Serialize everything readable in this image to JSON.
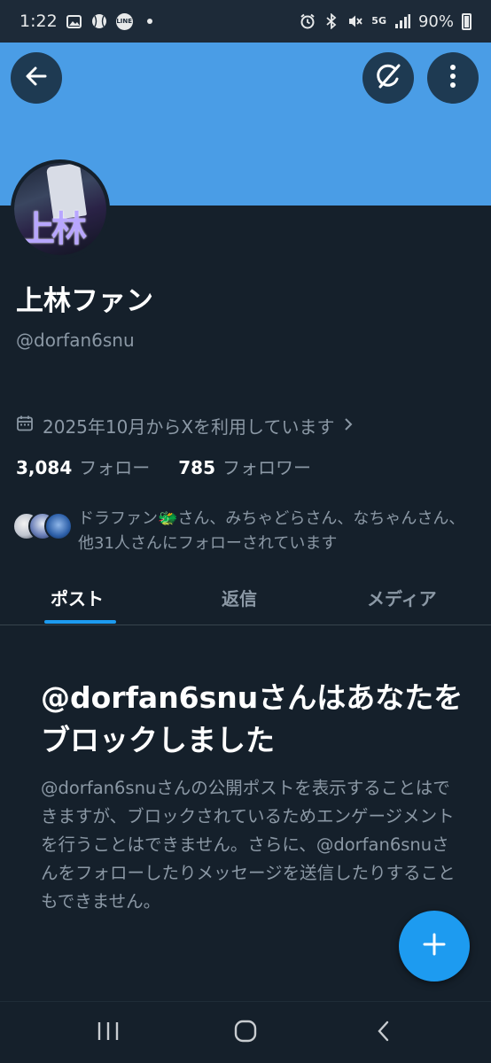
{
  "status_bar": {
    "time": "1:22",
    "network": "5G",
    "battery": "90%"
  },
  "header": {
    "back_icon": "arrow-left-icon",
    "grok_icon": "grok-icon",
    "more_icon": "more-vertical-icon",
    "banner_color": "#4a9de6"
  },
  "profile": {
    "avatar_kanji": "上林",
    "display_name": "上林ファン",
    "handle": "@dorfan6snu",
    "joined": "2025年10月からXを利用しています",
    "following_count": "3,084",
    "following_label": "フォロー",
    "followers_count": "785",
    "followers_label": "フォロワー",
    "followed_by": "ドラファン🐲さん、みちゃどらさん、なちゃんさん、他31人さんにフォローされています"
  },
  "tabs": [
    {
      "label": "ポスト",
      "active": true
    },
    {
      "label": "返信",
      "active": false
    },
    {
      "label": "メディア",
      "active": false
    }
  ],
  "blocked": {
    "title": "@dorfan6snuさんはあなたをブロックしました",
    "body": "@dorfan6snuさんの公開ポストを表示することはできますが、ブロックされているためエンゲージメントを行うことはできません。さらに、@dorfan6snuさんをフォローしたりメッセージを送信したりすることもできません。"
  },
  "fab": {
    "icon": "plus-icon",
    "color": "#1d9bf0"
  },
  "nav": {
    "recents_icon": "recents-icon",
    "home_icon": "home-icon",
    "back_icon": "back-chevron-icon"
  }
}
